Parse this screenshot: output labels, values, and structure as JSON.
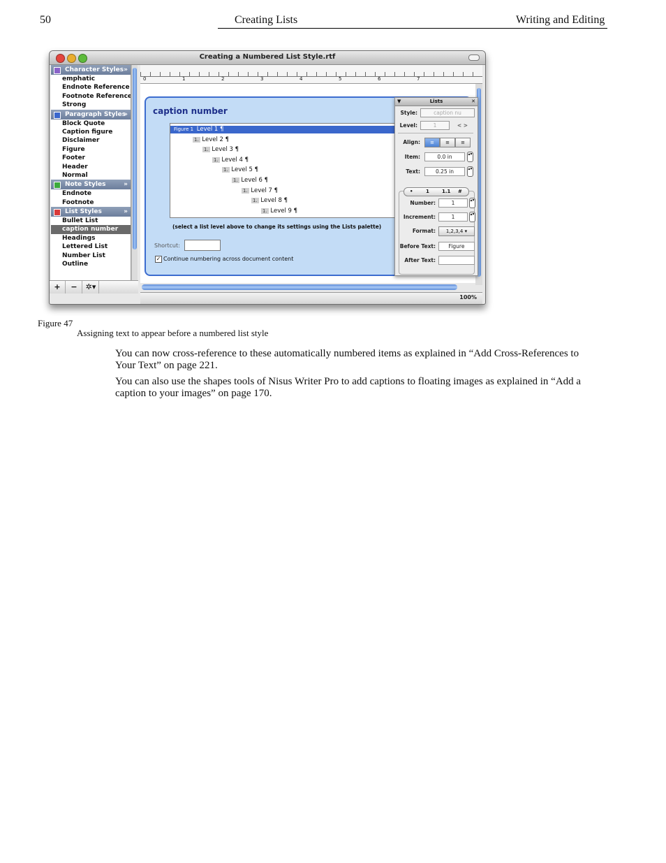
{
  "page": {
    "number": "50",
    "section": "Creating Lists",
    "chapter": "Writing and Editing"
  },
  "figure": {
    "label": "Figure 47",
    "caption": "Assigning text to appear before a numbered list style"
  },
  "paragraphs": [
    "You can now cross-reference to these automatically numbered items as explained in “Add Cross-References to Your Text” on page 221.",
    "You can also use the shapes tools of Nisus Writer Pro to add captions to floating images as explained in “Add a caption to your images” on page 170."
  ],
  "screenshot": {
    "window_title": "Creating a Numbered List Style.rtf",
    "sidebar": {
      "sections": [
        {
          "title": "Character Styles",
          "color": "#8a63c9",
          "items": [
            "emphatic",
            "Endnote Reference",
            "Footnote Reference",
            "Strong"
          ]
        },
        {
          "title": "Paragraph Styles",
          "color": "#3a67cc",
          "items": [
            "Block Quote",
            "Caption figure",
            "Disclaimer",
            "Figure",
            "Footer",
            "Header",
            "Normal"
          ]
        },
        {
          "title": "Note Styles",
          "color": "#3caa3c",
          "items": [
            "Endnote",
            "Footnote"
          ]
        },
        {
          "title": "List Styles",
          "color": "#d93a3a",
          "items": [
            "Bullet List",
            "caption number",
            "Headings",
            "Lettered List",
            "Number List",
            "Outline"
          ],
          "selected": "caption number"
        }
      ],
      "bottom_buttons": [
        "+",
        "−",
        "✲▾"
      ]
    },
    "ruler_numbers": [
      "0",
      "1",
      "2",
      "3",
      "4",
      "5",
      "6",
      "7"
    ],
    "style_editor": {
      "title": "caption number",
      "levels": [
        {
          "prefix": "Figure 1",
          "label": "Level 1"
        },
        {
          "prefix": "1.",
          "label": "Level 2"
        },
        {
          "prefix": "1.",
          "label": "Level 3"
        },
        {
          "prefix": "1.",
          "label": "Level 4"
        },
        {
          "prefix": "1.",
          "label": "Level 5"
        },
        {
          "prefix": "1.",
          "label": "Level 6"
        },
        {
          "prefix": "1.",
          "label": "Level 7"
        },
        {
          "prefix": "1.",
          "label": "Level 8"
        },
        {
          "prefix": "1.",
          "label": "Level 9"
        }
      ],
      "hint": "(select a list level above to change its settings using the Lists palette)",
      "shortcut_label": "Shortcut:",
      "continue_label": "Continue numbering across document content"
    },
    "lists_palette": {
      "title": "Lists",
      "style_label": "Style:",
      "style_value": "caption nu",
      "level_label": "Level:",
      "level_value": "1",
      "align_label": "Align:",
      "item_label": "Item:",
      "item_value": "0.0 in",
      "text_label": "Text:",
      "text_value": "0.25 in",
      "tabs": [
        "•",
        "1",
        "1.1",
        "#"
      ],
      "number_label": "Number:",
      "number_value": "1",
      "increment_label": "Increment:",
      "increment_value": "1",
      "format_label": "Format:",
      "format_value": "1,2,3,4",
      "before_label": "Before Text:",
      "before_value": "Figure",
      "after_label": "After Text:",
      "after_value": ""
    },
    "status_zoom": "100%"
  }
}
